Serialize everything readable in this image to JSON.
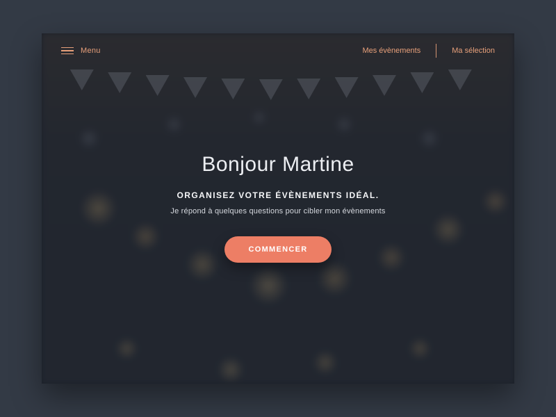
{
  "header": {
    "menu_label": "Menu",
    "nav": {
      "events_label": "Mes évènements",
      "selection_label": "Ma sélection"
    }
  },
  "hero": {
    "greeting": "Bonjour Martine",
    "subtitle": "ORGANISEZ VOTRE ÉVÈNEMENTS IDÉAL.",
    "description": "Je répond à quelques questions pour cibler mon évènements",
    "cta_label": "COMMENCER"
  },
  "colors": {
    "accent": "#e7a07a",
    "cta": "#ed7e65",
    "page_bg": "#333a45"
  }
}
